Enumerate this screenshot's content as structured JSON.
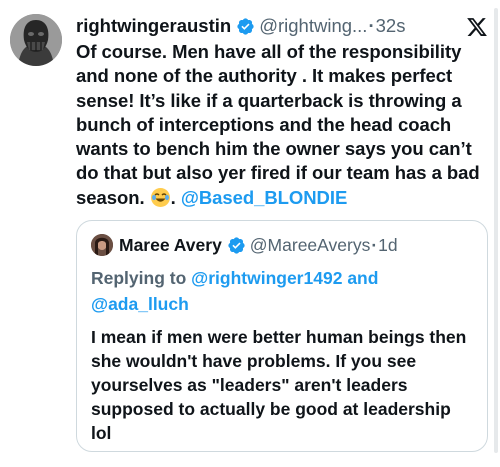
{
  "tweet": {
    "display_name": "rightwingeraustin",
    "handle": "@rightwing...",
    "separator": "·",
    "time": "32s",
    "text_body": "Of course.   Men have  all of the responsibility and none of the authority .   It   makes perfect sense!   It’s like if a quarterback is throwing a bunch of interceptions and the head coach wants to bench him the owner says you can’t do that but also yer fired if our team has a bad season.",
    "text_after_emoji": ".",
    "mention": "@Based_BLONDIE"
  },
  "quote": {
    "display_name": "Maree Avery",
    "handle": "@MareeAverys",
    "separator": "·",
    "time": "1d",
    "replying_label": "Replying to",
    "replying_user1": "@rightwinger1492",
    "replying_and": "and",
    "replying_user2": "@ada_lluch",
    "text": "I mean if men were better human beings then she wouldn't have problems. If you see yourselves as \"leaders\" aren't leaders supposed to actually be good at leadership lol"
  },
  "colors": {
    "accent": "#1d9bf0",
    "secondary_text": "#536471",
    "border": "#cfd9de"
  },
  "icons": [
    "verified-badge-icon",
    "x-logo-icon",
    "joy-emoji-icon"
  ]
}
